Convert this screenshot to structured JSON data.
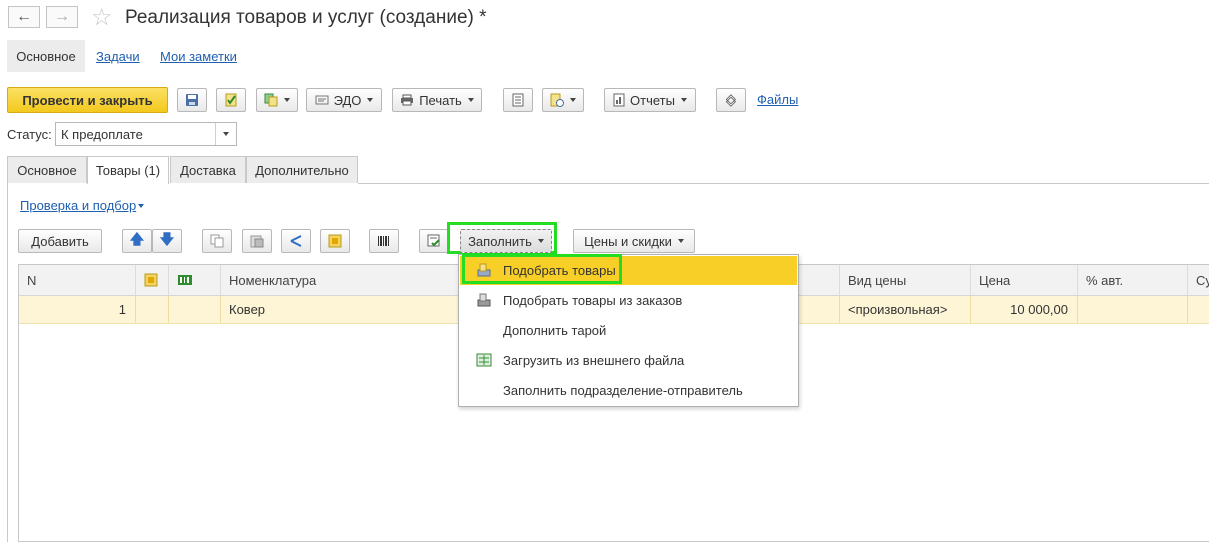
{
  "window": {
    "title": "Реализация товаров и услуг (создание) *"
  },
  "top_tabs": {
    "main": "Основное",
    "tasks": "Задачи",
    "notes": "Мои заметки"
  },
  "toolbar": {
    "post_close": "Провести и закрыть",
    "edo": "ЭДО",
    "print": "Печать",
    "reports": "Отчеты",
    "files": "Файлы"
  },
  "status": {
    "label": "Статус:",
    "value": "К предоплате"
  },
  "form_tabs": [
    "Основное",
    "Товары (1)",
    "Доставка",
    "Дополнительно"
  ],
  "goods": {
    "check_link": "Проверка и подбор",
    "add_label": "Добавить",
    "fill_label": "Заполнить",
    "prices_label": "Цены и скидки"
  },
  "table": {
    "headers": [
      "N",
      "",
      "",
      "Номенклатура",
      "Вид цены",
      "Цена",
      "% авт.",
      "Су"
    ],
    "rows": [
      {
        "n": "1",
        "item": "Ковер",
        "price_type": "<произвольная>",
        "price": "10 000,00"
      }
    ]
  },
  "fill_menu": {
    "items": [
      "Подобрать товары",
      "Подобрать товары из заказов",
      "Дополнить тарой",
      "Загрузить из внешнего файла",
      "Заполнить подразделение-отправитель"
    ]
  },
  "colors": {
    "accent_yellow": "#f7d338",
    "highlight_green": "#22dd22",
    "row_highlight": "#fdf5d6"
  }
}
